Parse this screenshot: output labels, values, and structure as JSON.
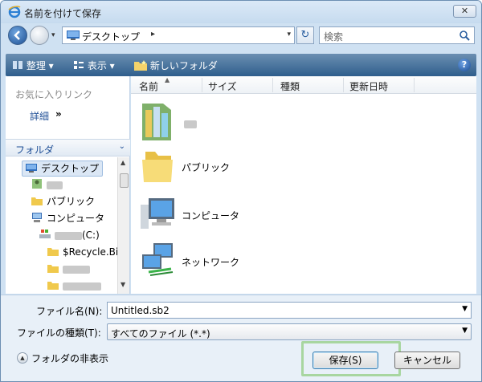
{
  "window": {
    "title": "名前を付けて保存",
    "close_label": "✕"
  },
  "nav": {
    "address": "デスクトップ",
    "address_sep": "▸",
    "search_placeholder": "検索"
  },
  "toolbar": {
    "organize": "整理 ▾",
    "view": "表示 ▾",
    "new_folder": "新しいフォルダ",
    "help": "?"
  },
  "nav_pane": {
    "favorites_title": "お気に入りリンク",
    "details_label": "詳細",
    "details_arrow": "»",
    "folders_label": "フォルダ",
    "folders_chev": "⌄",
    "tree": [
      {
        "label": "デスクトップ"
      },
      {
        "label": ""
      },
      {
        "label": "パブリック"
      },
      {
        "label": "コンピュータ"
      },
      {
        "label": "(C:)"
      },
      {
        "label": "$Recycle.Bi"
      },
      {
        "label": ""
      },
      {
        "label": ""
      }
    ]
  },
  "files": {
    "columns": [
      "名前",
      "サイズ",
      "種類",
      "更新日時"
    ],
    "items": [
      {
        "label": ""
      },
      {
        "label": "パブリック"
      },
      {
        "label": "コンピュータ"
      },
      {
        "label": "ネットワーク"
      }
    ]
  },
  "form": {
    "filename_label": "ファイル名(N):",
    "filename_value": "Untitled.sb2",
    "filetype_label": "ファイルの種類(T):",
    "filetype_value": "すべてのファイル (*.*)",
    "hide_folders": "フォルダの非表示",
    "save": "保存(S)",
    "cancel": "キャンセル"
  }
}
